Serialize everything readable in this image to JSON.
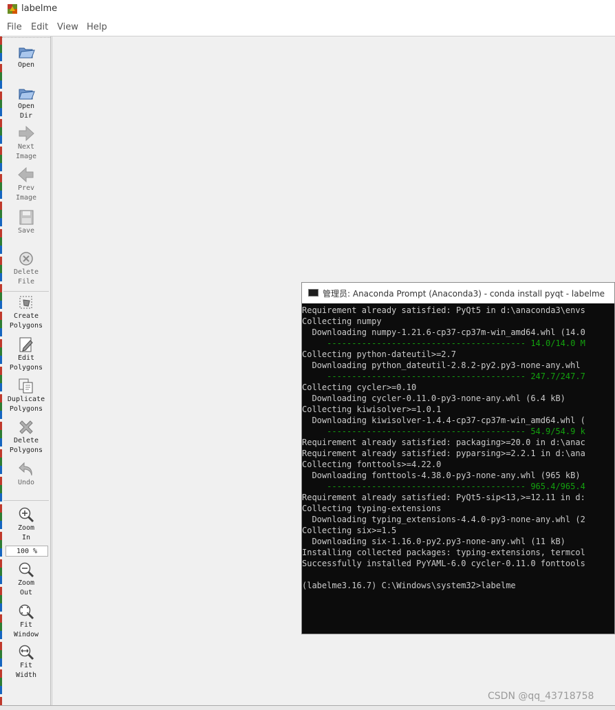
{
  "window": {
    "title": "labelme"
  },
  "menu": {
    "file": "File",
    "edit": "Edit",
    "view": "View",
    "help": "Help"
  },
  "toolbar": {
    "open": "Open",
    "open_dir": "Open\nDir",
    "next_image": "Next\nImage",
    "prev_image": "Prev\nImage",
    "save": "Save",
    "delete_file": "Delete\nFile",
    "create_polygons": "Create\nPolygons",
    "edit_polygons": "Edit\nPolygons",
    "duplicate_polygons": "Duplicate\nPolygons",
    "delete_polygons": "Delete\nPolygons",
    "undo": "Undo",
    "zoom_in": "Zoom\nIn",
    "zoom_level": "100 %",
    "zoom_out": "Zoom\nOut",
    "fit_window": "Fit\nWindow",
    "fit_width": "Fit\nWidth"
  },
  "terminal": {
    "title": "管理员: Anaconda Prompt (Anaconda3) - conda  install pyqt - labelme",
    "lines": [
      "Requirement already satisfied: PyQt5 in d:\\anaconda3\\envs",
      "Collecting numpy",
      "  Downloading numpy-1.21.6-cp37-cp37m-win_amd64.whl (14.0",
      "     ---------------------------------------- 14.0/14.0 M",
      "Collecting python-dateutil>=2.7",
      "  Downloading python_dateutil-2.8.2-py2.py3-none-any.whl",
      "     ---------------------------------------- 247.7/247.7",
      "Collecting cycler>=0.10",
      "  Downloading cycler-0.11.0-py3-none-any.whl (6.4 kB)",
      "Collecting kiwisolver>=1.0.1",
      "  Downloading kiwisolver-1.4.4-cp37-cp37m-win_amd64.whl (",
      "     ---------------------------------------- 54.9/54.9 k",
      "Requirement already satisfied: packaging>=20.0 in d:\\anac",
      "Requirement already satisfied: pyparsing>=2.2.1 in d:\\ana",
      "Collecting fonttools>=4.22.0",
      "  Downloading fonttools-4.38.0-py3-none-any.whl (965 kB)",
      "     ---------------------------------------- 965.4/965.4",
      "Requirement already satisfied: PyQt5-sip<13,>=12.11 in d:",
      "Collecting typing-extensions",
      "  Downloading typing_extensions-4.4.0-py3-none-any.whl (2",
      "Collecting six>=1.5",
      "  Downloading six-1.16.0-py2.py3-none-any.whl (11 kB)",
      "Installing collected packages: typing-extensions, termcol",
      "Successfully installed PyYAML-6.0 cycler-0.11.0 fonttools",
      "",
      "(labelme3.16.7) C:\\Windows\\system32>labelme"
    ]
  },
  "watermark": "CSDN @qq_43718758",
  "colors": {
    "terminal_bg": "#0c0c0c",
    "terminal_text": "#cccccc",
    "progress_green": "#13a10e"
  }
}
